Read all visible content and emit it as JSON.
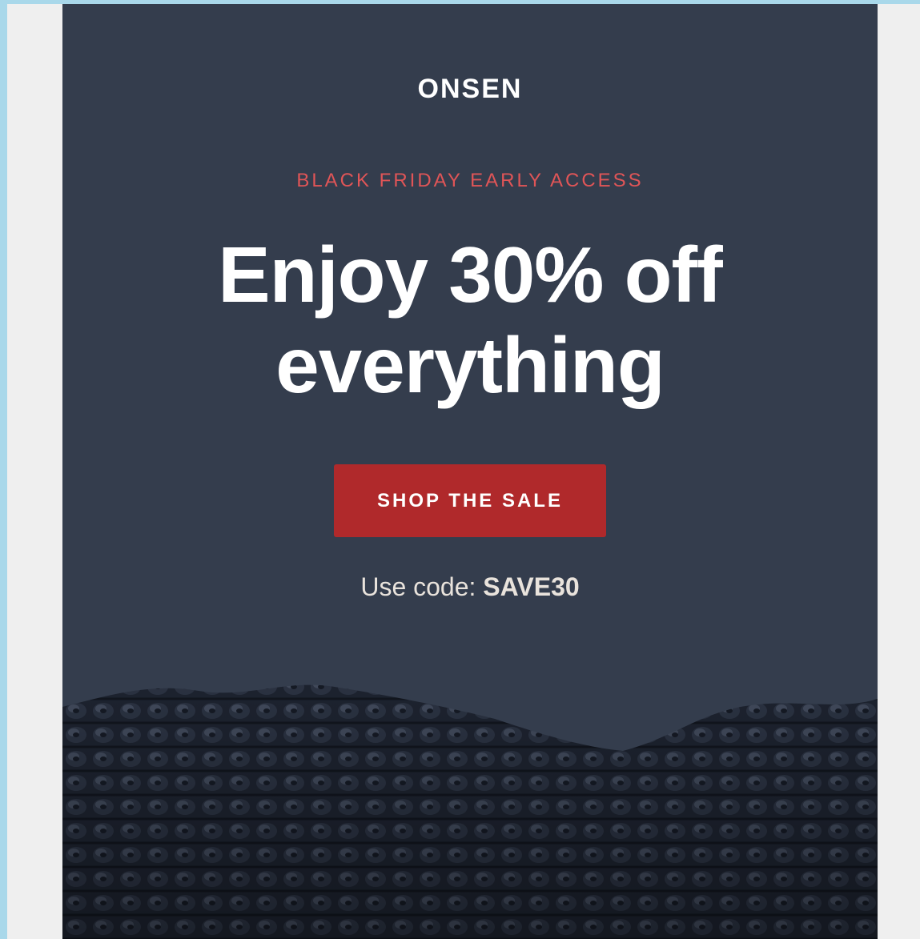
{
  "email": {
    "brand": "ONSEN",
    "eyebrow": "BLACK FRIDAY EARLY ACCESS",
    "headline_line1": "Enjoy 30% off",
    "headline_line2": "everything",
    "cta_label": "SHOP THE SALE",
    "code_prefix": "Use code:",
    "code_value": "SAVE30",
    "hero_image": "knitted-blanket-photo"
  },
  "colors": {
    "page_background": "#a9d8ea",
    "email_background": "#343d4d",
    "accent": "#e05557",
    "button": "#b0292b",
    "text": "#ffffff"
  }
}
